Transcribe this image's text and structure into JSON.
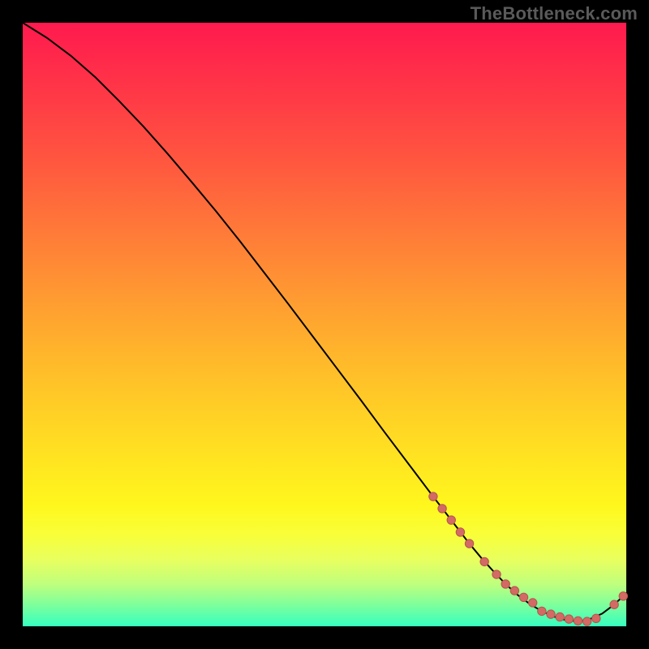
{
  "watermark": "TheBottleneck.com",
  "colors": {
    "curve_stroke": "#000000",
    "marker_fill": "#d36a63",
    "marker_stroke": "#b6554f"
  },
  "chart_data": {
    "type": "line",
    "title": "",
    "xlabel": "",
    "ylabel": "",
    "xlim": [
      0,
      100
    ],
    "ylim": [
      0,
      100
    ],
    "x": [
      0,
      4,
      8,
      12,
      16,
      20,
      24,
      28,
      32,
      36,
      40,
      44,
      48,
      52,
      56,
      60,
      64,
      68,
      72,
      74,
      76,
      78,
      80,
      82,
      84,
      86,
      88,
      90,
      92,
      94,
      96,
      98,
      100
    ],
    "y": [
      100,
      97.5,
      94.5,
      91,
      87,
      82.8,
      78.3,
      73.6,
      68.8,
      63.8,
      58.6,
      53.4,
      48.1,
      42.8,
      37.5,
      32.1,
      26.8,
      21.5,
      16.3,
      13.7,
      11.3,
      9.1,
      7.0,
      5.2,
      3.7,
      2.5,
      1.6,
      1.0,
      0.8,
      1.2,
      2.1,
      3.6,
      5.5
    ],
    "markers": {
      "x": [
        68,
        69.5,
        71,
        72.5,
        74,
        76.5,
        78.5,
        80,
        81.5,
        83,
        84.5,
        86,
        87.5,
        89,
        90.5,
        92,
        93.5,
        95,
        98,
        99.5
      ],
      "y": [
        21.5,
        19.5,
        17.6,
        15.6,
        13.7,
        10.7,
        8.6,
        7.0,
        5.9,
        4.8,
        3.9,
        2.5,
        2.0,
        1.55,
        1.2,
        0.9,
        0.8,
        1.3,
        3.6,
        5.0
      ]
    }
  }
}
